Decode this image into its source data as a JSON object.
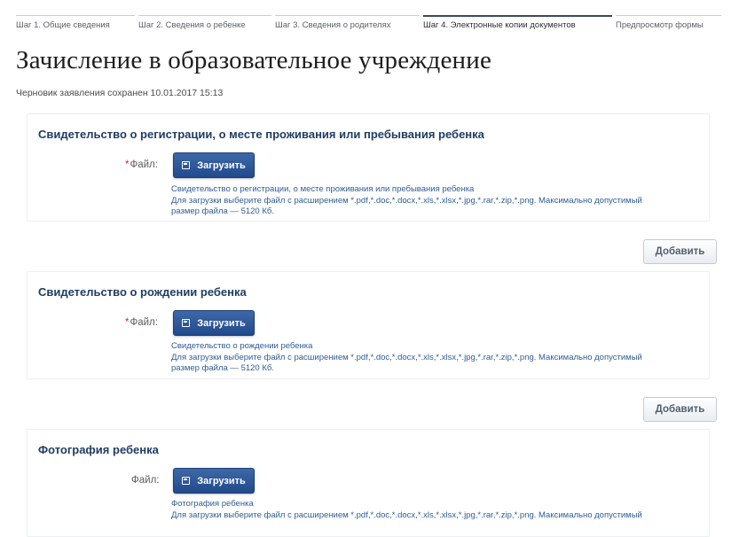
{
  "steps": [
    {
      "label": "Шаг 1. Общие сведения",
      "active": false
    },
    {
      "label": "Шаг 2. Сведения о ребенке",
      "active": false
    },
    {
      "label": "Шаг 3. Сведения о родителях",
      "active": false
    },
    {
      "label": "Шаг 4. Электронные копии документов",
      "active": true
    },
    {
      "label": "Предпросмотр формы",
      "active": false
    }
  ],
  "page": {
    "title": "Зачисление в образовательное учреждение",
    "draft_note": "Черновик заявления сохранен 10.01.2017 15:13"
  },
  "sections": [
    {
      "title": "Свидетельство о регистрации, о месте проживания или пребывания ребенка",
      "required_mark": "*",
      "field_label": "Файл:",
      "upload_label": "Загрузить",
      "hint_doc": "Свидетельство о регистрации, о месте проживания или пребывания ребенка",
      "hint_line1": "Для загрузки выберите файл с расширением *.pdf,*.doc,*.docx,*.xls,*.xlsx,*.jpg,*.rar,*.zip,*.png. Максимально допустимый",
      "hint_line2": "размер файла — 5120 Кб.",
      "add_label": "Добавить"
    },
    {
      "title": "Свидетельство о рождении ребенка",
      "required_mark": "*",
      "field_label": "Файл:",
      "upload_label": "Загрузить",
      "hint_doc": "Свидетельство о рождении ребенка",
      "hint_line1": "Для загрузки выберите файл с расширением *.pdf,*.doc,*.docx,*.xls,*.xlsx,*.jpg,*.rar,*.zip,*.png. Максимально допустимый",
      "hint_line2": "размер файла — 5120 Кб.",
      "add_label": "Добавить"
    },
    {
      "title": "Фотография ребенка",
      "field_label": "Файл:",
      "upload_label": "Загрузить",
      "hint_doc": "Фотография ребенка",
      "hint_line1": "Для загрузки выберите файл с расширением *.pdf,*.doc,*.docx,*.xls,*.xlsx,*.jpg,*.rar,*.zip,*.png. Максимально допустимый"
    }
  ],
  "icons": {
    "upload": "floppy-disk-icon"
  }
}
